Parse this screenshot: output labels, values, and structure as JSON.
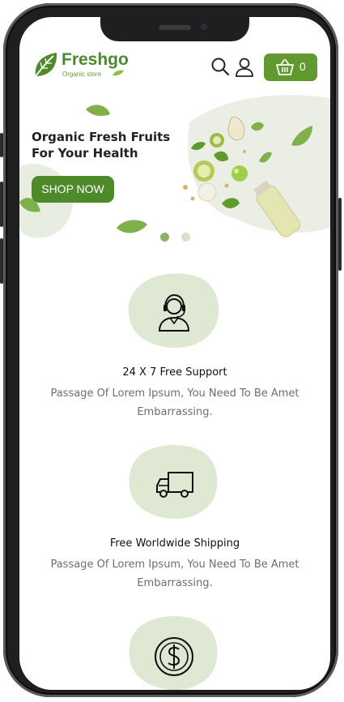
{
  "header": {
    "logo_name": "Freshgo",
    "logo_tagline": "Organic store",
    "cart_count": "0"
  },
  "banner": {
    "title_line1": "Organic Fresh Fruits",
    "title_line2": "For Your Health",
    "cta_label": "SHOP NOW",
    "slides": 2,
    "active_slide": 1
  },
  "features": [
    {
      "icon": "headset-support-icon",
      "title": "24 X 7 Free Support",
      "desc_line1": "Passage Of Lorem Ipsum, You Need To Be Amet",
      "desc_line2": "Embarrassing."
    },
    {
      "icon": "delivery-truck-icon",
      "title": "Free Worldwide Shipping",
      "desc_line1": "Passage Of Lorem Ipsum, You Need To Be Amet",
      "desc_line2": "Embarrassing."
    },
    {
      "icon": "dollar-coin-icon",
      "title": "",
      "desc_line1": "",
      "desc_line2": ""
    }
  ],
  "colors": {
    "brand_green": "#62992f",
    "button_green": "#4e8a2a",
    "blob_green": "#dfe8d2",
    "dot_active": "#8bb36a",
    "dot_inactive": "#d6e3c7"
  }
}
